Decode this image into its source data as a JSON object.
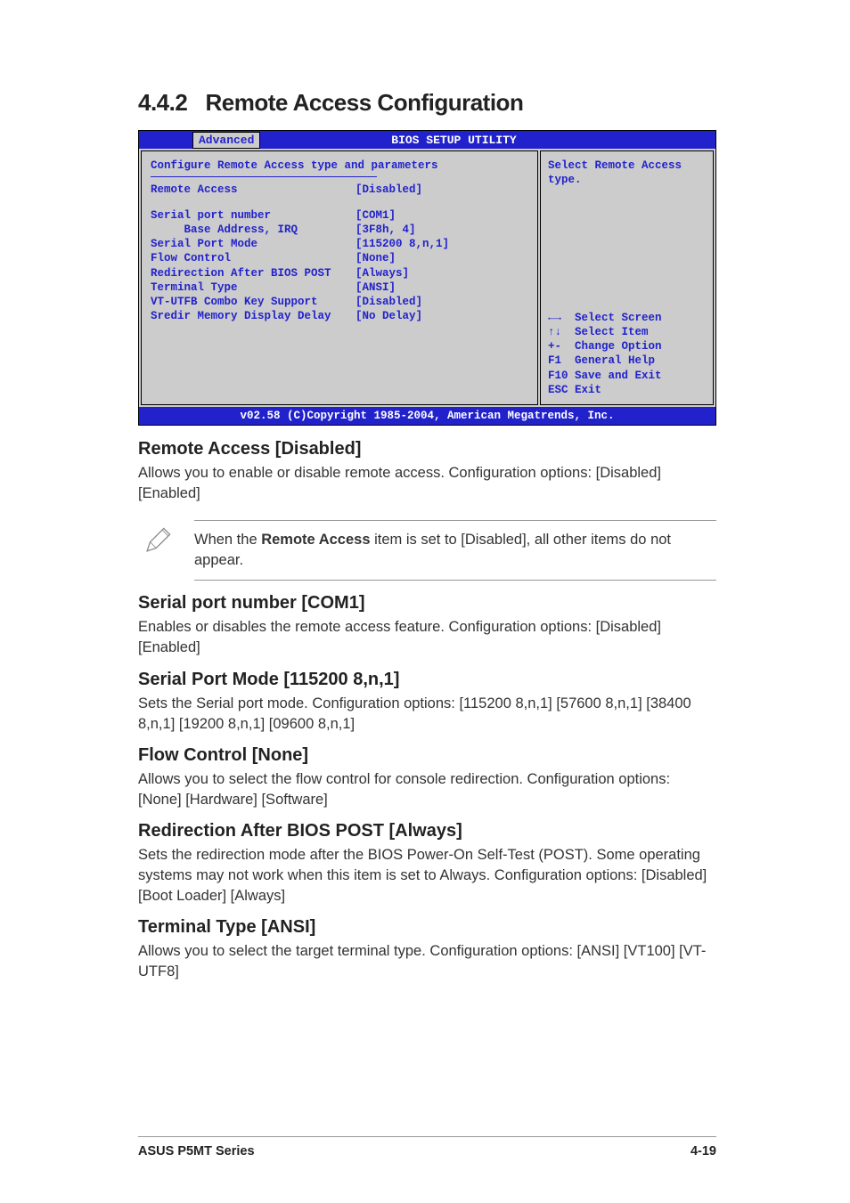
{
  "section": {
    "number": "4.4.2",
    "title": "Remote Access Configuration"
  },
  "bios": {
    "utility_title": "BIOS SETUP UTILITY",
    "tab": "Advanced",
    "panel_title": "Configure Remote Access type and parameters",
    "items": [
      {
        "label": "Remote Access",
        "value": "[Disabled]"
      },
      {
        "label": "Serial port number",
        "value": "[COM1]"
      },
      {
        "label": "     Base Address, IRQ",
        "value": "[3F8h, 4]"
      },
      {
        "label": "Serial Port Mode",
        "value": "[115200 8,n,1]"
      },
      {
        "label": "Flow Control",
        "value": "[None]"
      },
      {
        "label": "Redirection After BIOS POST",
        "value": "[Always]"
      },
      {
        "label": "Terminal Type",
        "value": "[ANSI]"
      },
      {
        "label": "VT-UTFB Combo Key Support",
        "value": "[Disabled]"
      },
      {
        "label": "Sredir Memory Display Delay",
        "value": "[No Delay]"
      }
    ],
    "help_top": "Select Remote Access type.",
    "help_keys": [
      {
        "k": "←→",
        "d": "Select Screen"
      },
      {
        "k": "↑↓",
        "d": "Select Item"
      },
      {
        "k": "+-",
        "d": "Change Option"
      },
      {
        "k": "F1",
        "d": "General Help"
      },
      {
        "k": "F10",
        "d": "Save and Exit"
      },
      {
        "k": "ESC",
        "d": "Exit"
      }
    ],
    "footer": "v02.58 (C)Copyright 1985-2004, American Megatrends, Inc."
  },
  "descriptions": {
    "remote_access": {
      "h": "Remote Access [Disabled]",
      "p": "Allows you to enable or disable remote access. Configuration options: [Disabled] [Enabled]"
    },
    "note": {
      "prefix": "When the ",
      "bold": "Remote Access",
      "suffix": " item is set to [Disabled], all other items do not appear."
    },
    "serial_port_number": {
      "h": "Serial port number [COM1]",
      "p": "Enables or disables the remote access feature. Configuration options: [Disabled] [Enabled]"
    },
    "serial_port_mode": {
      "h": "Serial Port Mode [115200 8,n,1]",
      "p": "Sets the Serial port mode. Configuration options: [115200 8,n,1] [57600 8,n,1] [38400 8,n,1] [19200 8,n,1] [09600 8,n,1]"
    },
    "flow_control": {
      "h": "Flow Control [None]",
      "p": "Allows you to select the flow control for console redirection. Configuration options: [None] [Hardware] [Software]"
    },
    "redirection": {
      "h": "Redirection After BIOS POST [Always]",
      "p": "Sets the redirection mode after the BIOS Power-On Self-Test (POST). Some operating systems may not work when this item is set to Always. Configuration options: [Disabled] [Boot Loader] [Always]"
    },
    "terminal_type": {
      "h": "Terminal Type [ANSI]",
      "p": "Allows you to select the target terminal type. Configuration options: [ANSI] [VT100] [VT-UTF8]"
    }
  },
  "footer": {
    "left": "ASUS P5MT Series",
    "right": "4-19"
  }
}
